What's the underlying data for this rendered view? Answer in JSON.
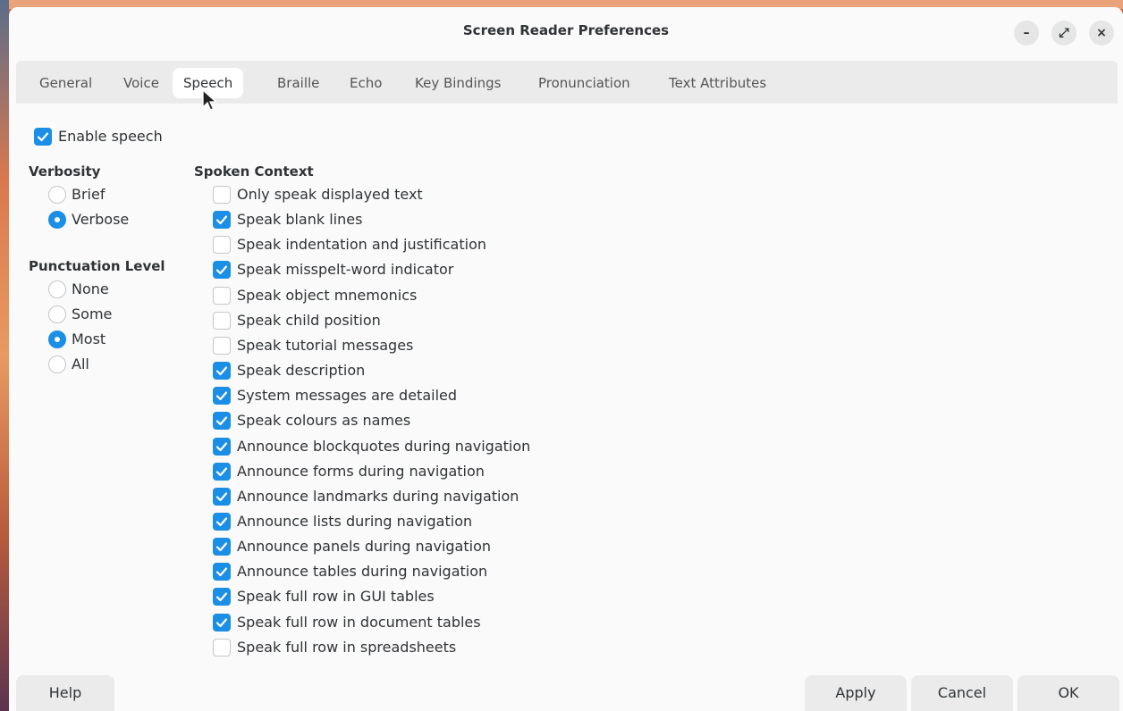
{
  "window": {
    "title": "Screen Reader Preferences",
    "controls": {
      "minimize": "–",
      "maximize": "⤢",
      "close": "×"
    }
  },
  "tabs": [
    {
      "label": "General"
    },
    {
      "label": "Voice"
    },
    {
      "label": "Speech",
      "active": true
    },
    {
      "label": "Braille"
    },
    {
      "label": "Echo"
    },
    {
      "label": "Key Bindings"
    },
    {
      "label": "Pronunciation"
    },
    {
      "label": "Text Attributes"
    }
  ],
  "speech": {
    "enable_label": "Enable speech",
    "enable_checked": true,
    "verbosity": {
      "heading": "Verbosity",
      "options": [
        {
          "label": "Brief",
          "selected": false
        },
        {
          "label": "Verbose",
          "selected": true
        }
      ]
    },
    "punctuation": {
      "heading": "Punctuation Level",
      "options": [
        {
          "label": "None",
          "selected": false
        },
        {
          "label": "Some",
          "selected": false
        },
        {
          "label": "Most",
          "selected": true
        },
        {
          "label": "All",
          "selected": false
        }
      ]
    },
    "spoken_context": {
      "heading": "Spoken Context",
      "items": [
        {
          "label": "Only speak displayed text",
          "checked": false
        },
        {
          "label": "Speak blank lines",
          "checked": true
        },
        {
          "label": "Speak indentation and justification",
          "checked": false
        },
        {
          "label": "Speak misspelt-word indicator",
          "checked": true
        },
        {
          "label": "Speak object mnemonics",
          "checked": false
        },
        {
          "label": "Speak child position",
          "checked": false
        },
        {
          "label": "Speak tutorial messages",
          "checked": false
        },
        {
          "label": "Speak description",
          "checked": true
        },
        {
          "label": "System messages are detailed",
          "checked": true
        },
        {
          "label": "Speak colours as names",
          "checked": true
        },
        {
          "label": "Announce blockquotes during navigation",
          "checked": true
        },
        {
          "label": "Announce forms during navigation",
          "checked": true
        },
        {
          "label": "Announce landmarks during navigation",
          "checked": true
        },
        {
          "label": "Announce lists during navigation",
          "checked": true
        },
        {
          "label": "Announce panels during navigation",
          "checked": true
        },
        {
          "label": "Announce tables during navigation",
          "checked": true
        },
        {
          "label": "Speak full row in GUI tables",
          "checked": true
        },
        {
          "label": "Speak full row in document tables",
          "checked": true
        },
        {
          "label": "Speak full row in spreadsheets",
          "checked": false
        }
      ]
    }
  },
  "footer": {
    "help": "Help",
    "apply": "Apply",
    "cancel": "Cancel",
    "ok": "OK"
  },
  "colors": {
    "accent": "#1b8ee5",
    "tab_bar": "#ebebeb",
    "window_bg": "#fafafa"
  }
}
